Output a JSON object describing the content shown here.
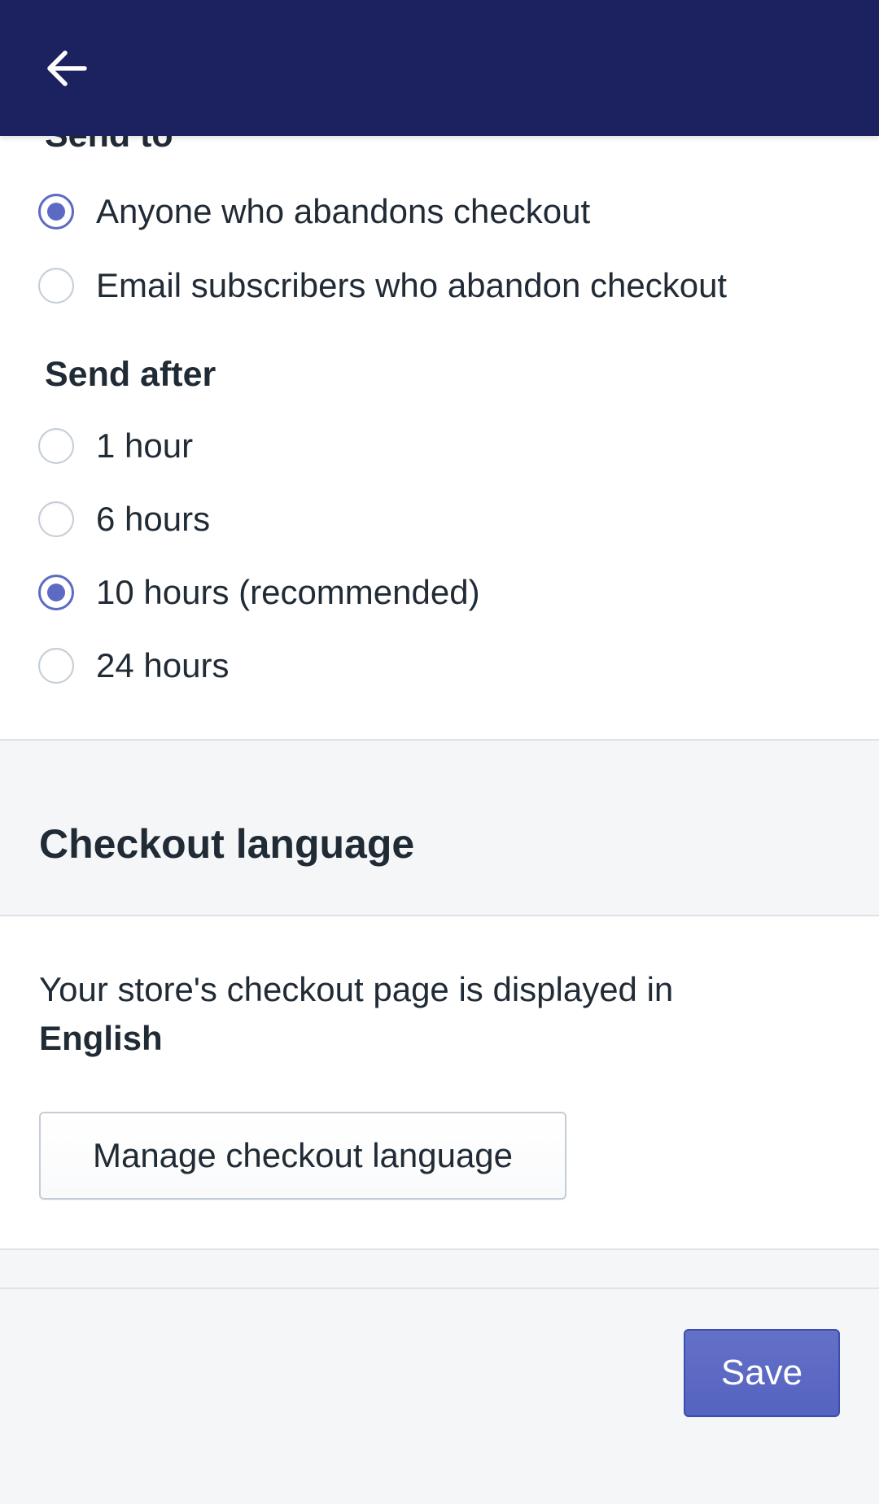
{
  "header": {
    "back_label": "Back"
  },
  "send_to": {
    "title": "Send to",
    "options": [
      {
        "label": "Anyone who abandons checkout",
        "checked": true
      },
      {
        "label": "Email subscribers who abandon checkout",
        "checked": false
      }
    ]
  },
  "send_after": {
    "title": "Send after",
    "options": [
      {
        "label": "1 hour",
        "checked": false
      },
      {
        "label": "6 hours",
        "checked": false
      },
      {
        "label": "10 hours (recommended)",
        "checked": true
      },
      {
        "label": "24 hours",
        "checked": false
      }
    ]
  },
  "checkout_language": {
    "heading": "Checkout language",
    "description": "Your store's checkout page is displayed in",
    "language": "English",
    "manage_button": "Manage checkout language"
  },
  "footer": {
    "save_button": "Save"
  },
  "colors": {
    "topbar": "#1c2260",
    "accent": "#5c6ac4",
    "page_background": "#f4f6f8",
    "text": "#212b36"
  },
  "icons": {
    "back": "arrow-left-icon"
  }
}
